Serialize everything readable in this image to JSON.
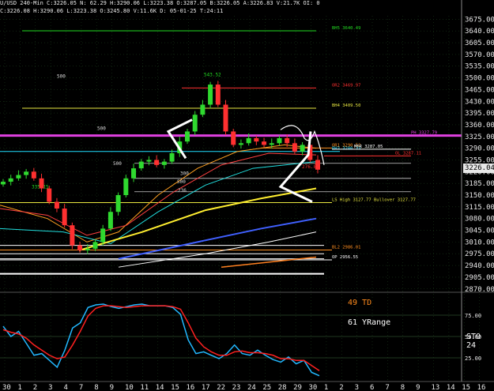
{
  "header": {
    "line1": "U/USD 240-Min",
    "line1_vals": "C:3226.05  N:  62.29  H:3290.06  L:3223.38  O:3287.05  B:3226.05  A:3226.83  V:21.7K  OI:  0",
    "line2": "C:3226.08  H:3290.06  L:3223.38  O:3245.80  V:11.6K  D:  05-01-25  T:24:11"
  },
  "current_price": "3226.04",
  "indicator_labels": {
    "td": "49 TD",
    "yrange": "61 YRange",
    "sto": "STO  24"
  },
  "colors": {
    "background": "#000000",
    "candle_up": "#2fd92f",
    "candle_down": "#ff3030",
    "grid": "#1a3a1a",
    "magenta": "#e040e0",
    "stoch_k": "#22b8ff",
    "stoch_d": "#ff2020"
  },
  "chart_data": [
    {
      "type": "candlestick",
      "title": "",
      "y_ticks": [
        "3675.00",
        "3640.00",
        "3605.00",
        "3570.00",
        "3535.00",
        "3500.00",
        "3465.00",
        "3430.00",
        "3395.00",
        "3360.00",
        "3325.00",
        "3290.00",
        "3255.00",
        "3220.00",
        "3185.00",
        "3150.00",
        "3115.00",
        "3080.00",
        "3045.00",
        "3010.00",
        "2975.00",
        "2940.00",
        "2905.00",
        "2870.00"
      ],
      "ylim": [
        2860,
        3690
      ],
      "x_ticks": [
        "30",
        "1",
        "2",
        "3",
        "4",
        "7",
        "8",
        "9",
        "10",
        "11",
        "14",
        "15",
        "16",
        "17",
        "22",
        "23",
        "24",
        "25",
        "28",
        "29",
        "30",
        "1",
        "2",
        "3",
        "6",
        "7",
        "8",
        "9",
        "13",
        "14",
        "15",
        "16"
      ],
      "grid": true,
      "close_path": [
        3190,
        3200,
        3210,
        3220,
        3200,
        3170,
        3130,
        3110,
        3060,
        3000,
        2985,
        2990,
        3010,
        3050,
        3100,
        3150,
        3200,
        3230,
        3250,
        3255,
        3240,
        3250,
        3275,
        3310,
        3340,
        3390,
        3420,
        3480,
        3420,
        3340,
        3300,
        3305,
        3320,
        3310,
        3300,
        3305,
        3320,
        3305,
        3280,
        3300,
        3255,
        3226
      ],
      "horizontal_levels": [
        {
          "price": 3640.49,
          "label": "BH5  3640.49",
          "color": "#22dd22"
        },
        {
          "price": 3409.5,
          "label": "BH4  3409.50",
          "color": "#e8e840"
        },
        {
          "price": 3469.97,
          "label": "OR2  3469.97",
          "color": "#ff3030"
        },
        {
          "price": 3327.79,
          "label": "PH  3327.79",
          "color": "#e040e0"
        },
        {
          "price": 3290.52,
          "label": "OR1  3290.52",
          "color": "#ff9020"
        },
        {
          "price": 3280.33,
          "label": "BH3  3280.33",
          "color": "#20ddff"
        },
        {
          "price": 3287.05,
          "label": "MTR  3287.05",
          "color": "#ffffff"
        },
        {
          "price": 3267.11,
          "label": "OL  3287.11",
          "color": "#ff3030"
        },
        {
          "price": 3127.77,
          "label": "LS High  3127.77  Bullover  3127.77",
          "color": "#e8e840"
        },
        {
          "price": 2986.01,
          "label": "BL2  2986.01",
          "color": "#ff9020"
        },
        {
          "price": 2956.55,
          "label": "OP  2956.55",
          "color": "#ffffff"
        }
      ],
      "annotations": [
        "543.52",
        "335.15",
        "500",
        "500",
        "500",
        "500",
        "276.86",
        "300",
        "236"
      ]
    },
    {
      "type": "line",
      "title": "",
      "y_ticks": [
        "75.00",
        "50.00",
        "25.00"
      ],
      "ylim": [
        0,
        100
      ],
      "series": [
        {
          "name": "",
          "values": [
            62,
            50,
            56,
            42,
            28,
            30,
            22,
            14,
            34,
            60,
            66,
            84,
            87,
            88,
            85,
            83,
            85,
            87,
            88,
            86,
            86,
            86,
            84,
            76,
            46,
            30,
            32,
            28,
            24,
            30,
            40,
            30,
            28,
            34,
            28,
            23,
            20,
            26,
            18,
            22,
            8,
            4
          ]
        },
        {
          "name": "",
          "values": [
            58,
            55,
            53,
            48,
            40,
            34,
            28,
            24,
            26,
            40,
            56,
            74,
            83,
            86,
            86,
            85,
            84,
            85,
            86,
            86,
            86,
            86,
            85,
            82,
            66,
            48,
            38,
            32,
            28,
            28,
            32,
            33,
            31,
            31,
            30,
            28,
            24,
            24,
            22,
            22,
            16,
            10
          ]
        }
      ]
    }
  ]
}
